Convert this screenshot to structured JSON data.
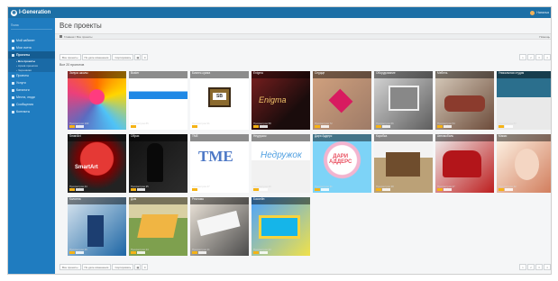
{
  "app": {
    "name": "I-Generation",
    "user_name": "Наталья"
  },
  "sidebar": {
    "search_placeholder": "Поиск",
    "items": [
      {
        "label": "Мой кабинет",
        "icon": "home-icon",
        "active": false
      },
      {
        "label": "Мои счета",
        "icon": "card-icon",
        "active": false
      },
      {
        "label": "Проекты",
        "icon": "folder-icon",
        "active": true
      },
      {
        "label": "Проекты",
        "icon": "list-icon",
        "active": false
      },
      {
        "label": "Услуги",
        "icon": "service-icon",
        "active": false
      },
      {
        "label": "Каталоги",
        "icon": "catalog-icon",
        "active": false
      },
      {
        "label": "Места, люди",
        "icon": "people-icon",
        "active": false
      },
      {
        "label": "Сообщения",
        "icon": "message-icon",
        "active": false
      },
      {
        "label": "Контакты",
        "icon": "contact-icon",
        "active": false
      }
    ],
    "subitems": [
      {
        "label": "Все проекты",
        "active": true
      },
      {
        "label": "Архив проектов",
        "active": false
      },
      {
        "label": "Черновики",
        "active": false
      }
    ]
  },
  "page": {
    "title": "Все проекты",
    "breadcrumb": [
      "Главная",
      "Все проекты"
    ],
    "help": "Помощь",
    "count": "Все 20 проектов",
    "toolbar": {
      "buttons": [
        "Все проекты",
        "По дате изменения",
        "Сортировать"
      ]
    },
    "pagination": [
      "1",
      "2",
      "3",
      "4"
    ]
  },
  "projects": [
    {
      "title": "Запуск школы",
      "foot": "Просмотров 100"
    },
    {
      "title": "Buster",
      "foot": "Просмотров 85"
    },
    {
      "title": "Бизнес-сумка",
      "foot": "Просмотров 91"
    },
    {
      "title": "Enigma",
      "foot": "Просмотров 58"
    },
    {
      "title": "Сердце",
      "foot": "Просмотров 72"
    },
    {
      "title": "Оборудование",
      "foot": "Просмотров 66"
    },
    {
      "title": "Мебель",
      "foot": "Просмотров 54"
    },
    {
      "title": "Уникальная студия",
      "foot": "Просмотров 80"
    },
    {
      "title": "SmartArt",
      "foot": "Просмотров 44"
    },
    {
      "title": "Образ",
      "foot": "Просмотров 35"
    },
    {
      "title": "TME",
      "foot": "Просмотров 47"
    },
    {
      "title": "Недружок",
      "foot": "Просмотров 29"
    },
    {
      "title": "Дари Аддерс",
      "foot": "Просмотров 31"
    },
    {
      "title": "Коробка",
      "foot": "Просмотров 38"
    },
    {
      "title": "Автомобиль",
      "foot": "Просмотров 27"
    },
    {
      "title": "Маски",
      "foot": "Просмотров 42"
    },
    {
      "title": "Колонна",
      "foot": "Просмотров 39"
    },
    {
      "title": "Дом",
      "foot": "Просмотров 24"
    },
    {
      "title": "Реклама",
      "foot": "Просмотров 21"
    },
    {
      "title": "Бассейн",
      "foot": "Просмотров 33"
    }
  ]
}
